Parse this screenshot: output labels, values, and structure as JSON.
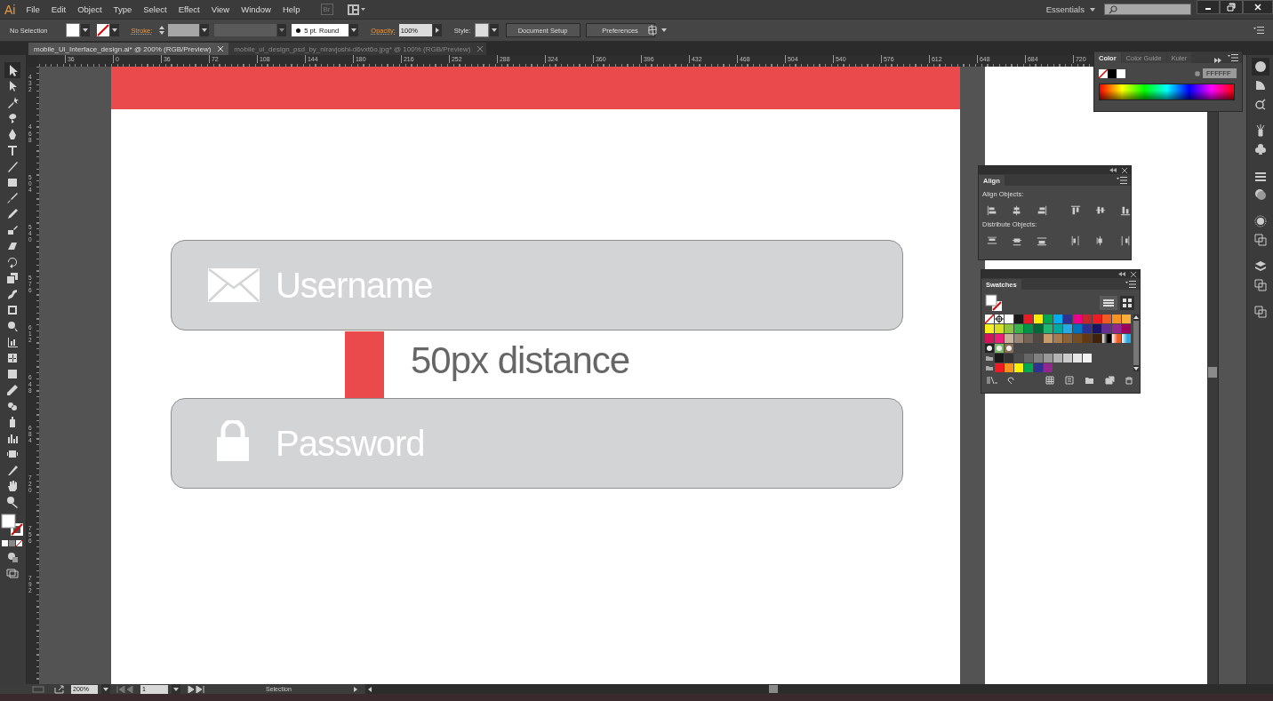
{
  "app": {
    "logo": "Ai",
    "bridge": "Br"
  },
  "menu": [
    "File",
    "Edit",
    "Object",
    "Type",
    "Select",
    "Effect",
    "View",
    "Window",
    "Help"
  ],
  "workspace": {
    "label": "Essentials"
  },
  "control_bar": {
    "selection": "No Selection",
    "stroke_label": "Stroke:",
    "brush": "5 pt. Round",
    "opacity_label": "Opacity:",
    "opacity": "100%",
    "style_label": "Style:",
    "buttons": [
      "Document Setup",
      "Preferences"
    ]
  },
  "tabs": [
    {
      "label": "mobile_Ui_Interface_design.ai* @ 200% (RGB/Preview)",
      "selected": true
    },
    {
      "label": "mobile_ui_design_psd_by_niravjoshi-d6vxt6o.jpg* @ 100% (RGB/Preview)",
      "selected": false
    }
  ],
  "rulers": {
    "horizontal": [
      "36",
      "0",
      "36",
      "72",
      "108",
      "144",
      "180",
      "216",
      "252",
      "288",
      "324",
      "360",
      "396",
      "432",
      "468",
      "504",
      "540",
      "576",
      "612",
      "648",
      "684",
      "720"
    ],
    "vertical": [
      "432",
      "468",
      "504",
      "540",
      "576",
      "612",
      "648",
      "684",
      "720",
      "756",
      "792"
    ]
  },
  "artboard": {
    "fields": [
      {
        "kind": "email",
        "label": "Username"
      },
      {
        "kind": "lock",
        "label": "Password"
      }
    ],
    "spacer_label": "50px distance"
  },
  "color_panel": {
    "tabs": [
      {
        "label": "Color",
        "selected": true
      },
      {
        "label": "Color Guide",
        "selected": false
      },
      {
        "label": "Kuler",
        "selected": false
      }
    ],
    "hex": "FFFFFF"
  },
  "align_panel": {
    "title": "Align",
    "align_label": "Align Objects:",
    "distribute_label": "Distribute Objects:"
  },
  "swatches_panel": {
    "title": "Swatches",
    "rows": [
      [
        {
          "kind": "none"
        },
        {
          "kind": "registration"
        },
        {
          "kind": "color",
          "color": "#ffffff"
        },
        {
          "kind": "color",
          "color": "#1a1a1a"
        },
        {
          "kind": "color",
          "color": "#e31e24"
        },
        {
          "kind": "color",
          "color": "#ffed00"
        },
        {
          "kind": "color",
          "color": "#00a651"
        },
        {
          "kind": "color",
          "color": "#00aeef"
        },
        {
          "kind": "color",
          "color": "#2e3192"
        },
        {
          "kind": "color",
          "color": "#ec008c"
        },
        {
          "kind": "color",
          "color": "#c1272d"
        },
        {
          "kind": "color",
          "color": "#ed1c24"
        },
        {
          "kind": "color",
          "color": "#f15a24"
        },
        {
          "kind": "color",
          "color": "#f7931e"
        },
        {
          "kind": "color",
          "color": "#fbb03b"
        }
      ],
      [
        {
          "kind": "color",
          "color": "#fcee21"
        },
        {
          "kind": "color",
          "color": "#d9e021"
        },
        {
          "kind": "color",
          "color": "#8cc63f"
        },
        {
          "kind": "color",
          "color": "#39b54a"
        },
        {
          "kind": "color",
          "color": "#009245"
        },
        {
          "kind": "color",
          "color": "#006837"
        },
        {
          "kind": "color",
          "color": "#22b573"
        },
        {
          "kind": "color",
          "color": "#00a99d"
        },
        {
          "kind": "color",
          "color": "#29abe2"
        },
        {
          "kind": "color",
          "color": "#0071bc"
        },
        {
          "kind": "color",
          "color": "#2e3192"
        },
        {
          "kind": "color",
          "color": "#1b1464"
        },
        {
          "kind": "color",
          "color": "#662d91"
        },
        {
          "kind": "color",
          "color": "#93278f"
        },
        {
          "kind": "color",
          "color": "#9e005d"
        }
      ],
      [
        {
          "kind": "color",
          "color": "#d4145a"
        },
        {
          "kind": "color",
          "color": "#ed1e79"
        },
        {
          "kind": "color",
          "color": "#c7b299"
        },
        {
          "kind": "color",
          "color": "#998675"
        },
        {
          "kind": "color",
          "color": "#736357"
        },
        {
          "kind": "color",
          "color": "#534741"
        },
        {
          "kind": "color",
          "color": "#c69c6d"
        },
        {
          "kind": "color",
          "color": "#a67c52"
        },
        {
          "kind": "color",
          "color": "#8c6239"
        },
        {
          "kind": "color",
          "color": "#754c24"
        },
        {
          "kind": "color",
          "color": "#603813"
        },
        {
          "kind": "color",
          "color": "#42210b"
        },
        {
          "kind": "gradient",
          "color": "#000000"
        },
        {
          "kind": "gradient",
          "color": "#f15a24"
        },
        {
          "kind": "gradient",
          "color": "#29abe2"
        }
      ],
      [
        {
          "kind": "pattern"
        },
        {
          "kind": "pattern"
        },
        {
          "kind": "pattern"
        }
      ],
      [
        {
          "kind": "group"
        },
        {
          "kind": "color",
          "color": "#1a1a1a"
        },
        {
          "kind": "color",
          "color": "#333333"
        },
        {
          "kind": "color",
          "color": "#4d4d4d"
        },
        {
          "kind": "color",
          "color": "#666666"
        },
        {
          "kind": "color",
          "color": "#808080"
        },
        {
          "kind": "color",
          "color": "#999999"
        },
        {
          "kind": "color",
          "color": "#b3b3b3"
        },
        {
          "kind": "color",
          "color": "#cccccc"
        },
        {
          "kind": "color",
          "color": "#e6e6e6"
        },
        {
          "kind": "color",
          "color": "#f2f2f2"
        }
      ],
      [
        {
          "kind": "group"
        },
        {
          "kind": "color",
          "color": "#ed1c24"
        },
        {
          "kind": "color",
          "color": "#f7931e"
        },
        {
          "kind": "color",
          "color": "#fff200"
        },
        {
          "kind": "color",
          "color": "#00a651"
        },
        {
          "kind": "color",
          "color": "#2e3192"
        },
        {
          "kind": "color",
          "color": "#92278f"
        }
      ]
    ]
  },
  "status_bar": {
    "zoom": "200%",
    "page": "1",
    "tool": "Selection"
  }
}
